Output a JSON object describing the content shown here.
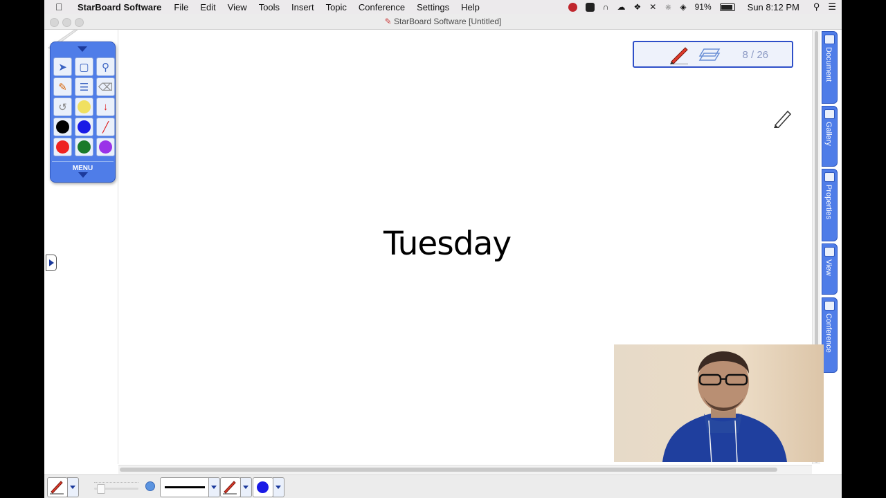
{
  "menubar": {
    "app_name": "StarBoard Software",
    "items": [
      "File",
      "Edit",
      "View",
      "Tools",
      "Insert",
      "Topic",
      "Conference",
      "Settings",
      "Help"
    ],
    "battery": "91%",
    "clock": "Sun 8:12 PM"
  },
  "window": {
    "title": "StarBoard Software [Untitled]"
  },
  "toolbox": {
    "menu_label": "MENU"
  },
  "page_indicator": {
    "text": "8 / 26"
  },
  "canvas": {
    "word": "Tuesday"
  },
  "side_tabs": [
    "Document",
    "Gallery",
    "Properties",
    "View",
    "Conference"
  ],
  "pen_colors": {
    "black": "#000000",
    "blue": "#1a1ae6",
    "red": "#ee2222",
    "green": "#1a7a2a",
    "purple": "#9a33e8",
    "yellow": "#f0e060"
  },
  "accent": "#4f7de8"
}
